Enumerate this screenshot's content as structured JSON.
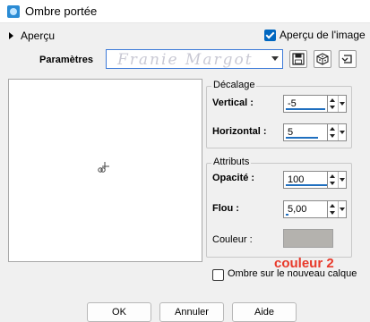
{
  "window": {
    "title": "Ombre portée",
    "icon": "app-icon"
  },
  "preview_toggle": {
    "label": "Aperçu",
    "icon": "expand-triangle-icon"
  },
  "preview_image_checkbox": {
    "label": "Aperçu de l'image",
    "checked": true
  },
  "presets": {
    "label": "Paramètres",
    "watermark": "Franie Margot",
    "tools": [
      "save-preset-icon",
      "randomize-icon",
      "reset-icon"
    ]
  },
  "offset_group": {
    "title": "Décalage",
    "vertical": {
      "label": "Vertical :",
      "value": "-5"
    },
    "horizontal": {
      "label": "Horizontal :",
      "value": "5"
    }
  },
  "attributes_group": {
    "title": "Attributs",
    "opacity": {
      "label": "Opacité :",
      "value": "100"
    },
    "blur": {
      "label": "Flou :",
      "value": "5,00"
    },
    "color": {
      "label": "Couleur :",
      "value": "#b4b2ae"
    }
  },
  "annotation": "couleur 2",
  "new_layer_checkbox": {
    "label": "Ombre sur le nouveau calque",
    "checked": false
  },
  "buttons": {
    "ok": "OK",
    "cancel": "Annuler",
    "help": "Aide"
  },
  "colors": {
    "accent": "#0067c0",
    "annotation": "#e8392a",
    "shadow_color": "#b4b2ae"
  }
}
